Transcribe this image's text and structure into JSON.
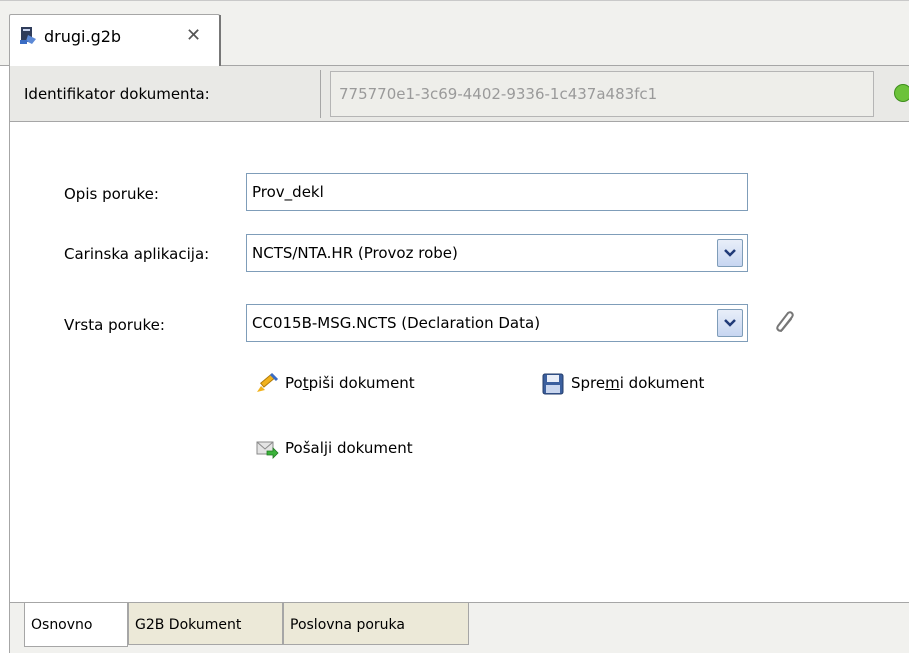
{
  "editor_tab": {
    "title": "drugi.g2b",
    "close": "✕"
  },
  "identifier": {
    "label": "Identifikator dokumenta:",
    "value": "775770e1-3c69-4402-9336-1c437a483fc1"
  },
  "form": {
    "opis_label": "Opis poruke:",
    "opis_value": "Prov_dekl",
    "carinska_label": "Carinska aplikacija:",
    "carinska_value": "NCTS/NTA.HR (Provoz robe)",
    "vrsta_label": "Vrsta poruke:",
    "vrsta_value": "CC015B-MSG.NCTS (Declaration Data)"
  },
  "actions": {
    "potpisi": {
      "pre": "Po",
      "mnemonic": "t",
      "post": "piši dokument"
    },
    "spremi": {
      "pre": "Spre",
      "mnemonic": "m",
      "post": "i dokument"
    },
    "posalji": "Pošalji dokument"
  },
  "bottom_tabs": [
    "Osnovno",
    "G2B Dokument",
    "Poslovna poruka"
  ],
  "colors": {
    "field_border": "#7f9db9",
    "tab_bg": "#ece9d8",
    "readonly_text": "#9a9a9a"
  }
}
